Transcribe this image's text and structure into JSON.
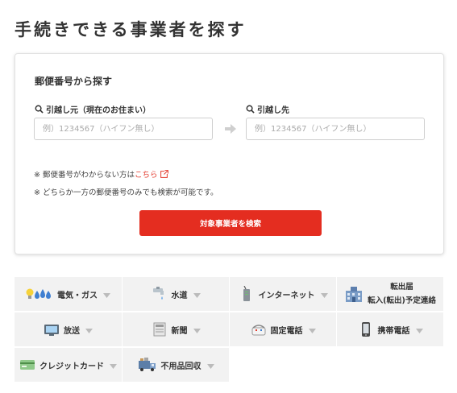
{
  "page": {
    "title": "手続きできる事業者を探す"
  },
  "search": {
    "heading": "郵便番号から探す",
    "from_label": "引越し元（現在のお住まい）",
    "to_label": "引越し先",
    "from_placeholder": "例）1234567（ハイフン無し）",
    "to_placeholder": "例）1234567（ハイフン無し）",
    "note1_prefix": "※ 郵便番号がわからない方は",
    "note1_link": "こちら",
    "note2": "※ どちらか一方の郵便番号のみでも検索が可能です。",
    "button_label": "対象事業者を検索",
    "button_color": "#e42d20"
  },
  "categories": [
    {
      "label": "電気・ガス",
      "icon": "electricity-gas-icon"
    },
    {
      "label": "水道",
      "icon": "faucet-icon"
    },
    {
      "label": "インターネット",
      "icon": "router-icon"
    },
    {
      "label_line1": "転出届",
      "label_line2": "転入(転出)予定連絡",
      "icon": "city-hall-icon"
    },
    {
      "label": "放送",
      "icon": "tv-icon"
    },
    {
      "label": "新聞",
      "icon": "newspaper-icon"
    },
    {
      "label": "固定電話",
      "icon": "landline-phone-icon"
    },
    {
      "label": "携帯電話",
      "icon": "mobile-phone-icon"
    },
    {
      "label": "クレジットカード",
      "icon": "credit-card-icon"
    },
    {
      "label": "不用品回収",
      "icon": "truck-icon"
    }
  ]
}
